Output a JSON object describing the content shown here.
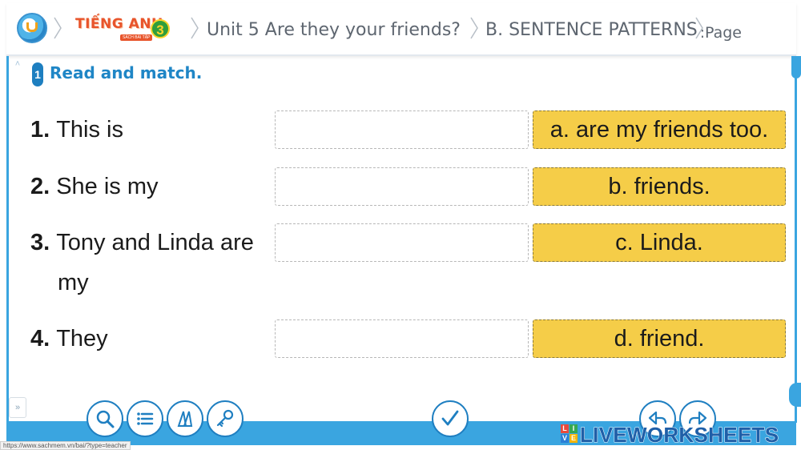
{
  "header": {
    "brand_title": "TIẾNG ANH",
    "brand_sub": "SÁCH BÀI TẬP",
    "brand_grade": "3",
    "breadcrumb_unit": "Unit 5 Are they your friends?",
    "breadcrumb_section": "B. SENTENCE PATTERNS",
    "breadcrumb_page": "Page:"
  },
  "exercise": {
    "number": "1",
    "title": "Read and match."
  },
  "questions": [
    {
      "num": "1.",
      "text": "This is",
      "text2": ""
    },
    {
      "num": "2.",
      "text": "She is my",
      "text2": ""
    },
    {
      "num": "3.",
      "text": "Tony and Linda are",
      "text2": "my"
    },
    {
      "num": "4.",
      "text": "They",
      "text2": ""
    }
  ],
  "options": [
    "a. are my friends too.",
    "b. friends.",
    "c. Linda.",
    "d. friend."
  ],
  "toolbar": {
    "icons": [
      "search-icon",
      "list-icon",
      "pages-icon",
      "key-icon",
      "check-icon",
      "back-icon",
      "forward-icon"
    ]
  },
  "footer": {
    "brand": "LIVEWORKSHEETS",
    "status_url": "https://www.sachmem.vn/bai/?type=teacher"
  },
  "colors": {
    "accent": "#3aa5e0",
    "option_fill": "#f5cd48",
    "title_blue": "#1f86c6",
    "brand_orange": "#e8542b"
  }
}
